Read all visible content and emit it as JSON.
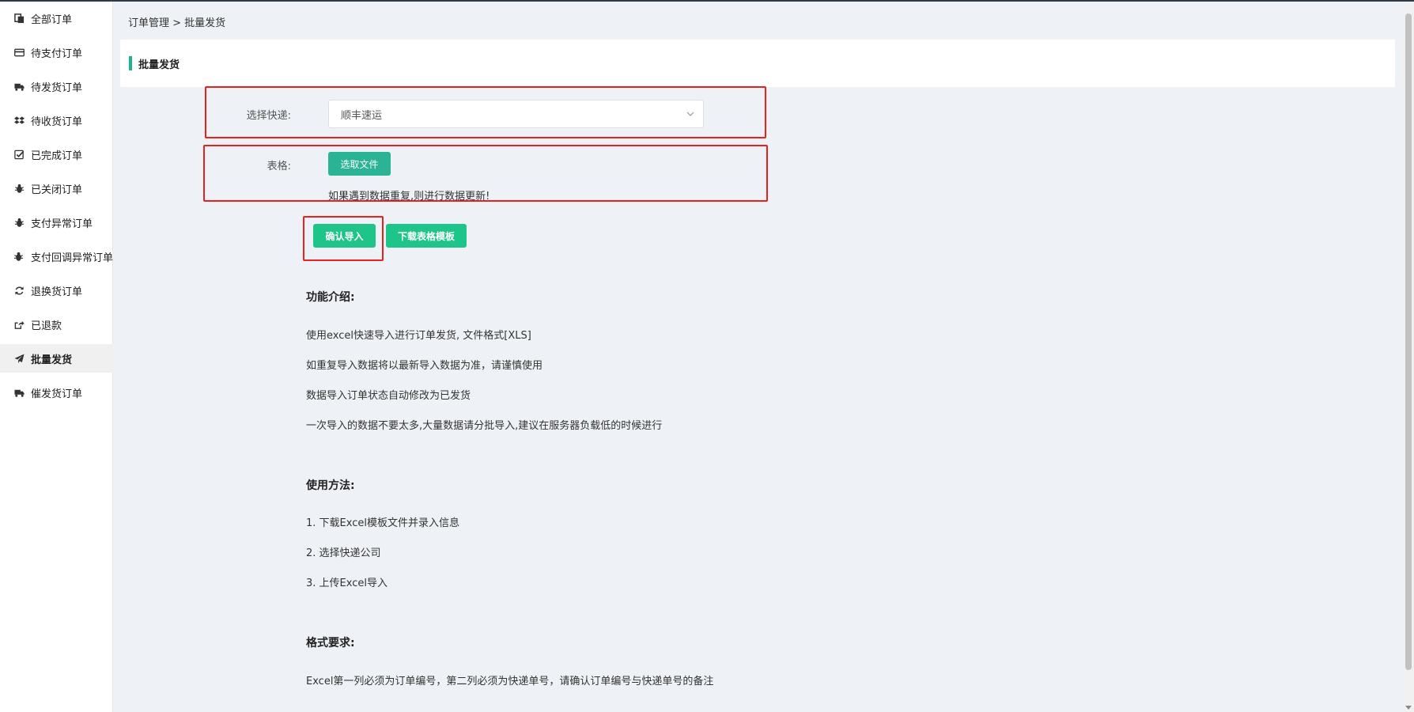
{
  "sidebar": {
    "items": [
      {
        "label": "全部订单",
        "icon": "copy-icon"
      },
      {
        "label": "待支付订单",
        "icon": "credit-card-icon"
      },
      {
        "label": "待发货订单",
        "icon": "truck-icon"
      },
      {
        "label": "待收货订单",
        "icon": "dropbox-icon"
      },
      {
        "label": "已完成订单",
        "icon": "check-square-icon"
      },
      {
        "label": "已关闭订单",
        "icon": "bug-icon"
      },
      {
        "label": "支付异常订单",
        "icon": "bug-icon"
      },
      {
        "label": "支付回调异常订单",
        "icon": "bug-icon"
      },
      {
        "label": "退换货订单",
        "icon": "refresh-icon"
      },
      {
        "label": "已退款",
        "icon": "share-square-icon"
      },
      {
        "label": "批量发货",
        "icon": "paper-plane-icon",
        "active": true
      },
      {
        "label": "催发货订单",
        "icon": "truck-icon"
      }
    ]
  },
  "breadcrumb": "订单管理 > 批量发货",
  "card": {
    "title": "批量发货"
  },
  "form": {
    "express_label": "选择快递:",
    "express_value": "顺丰速运",
    "table_label": "表格:",
    "choose_file_label": "选取文件",
    "hint": "如果遇到数据重复,则进行数据更新!",
    "confirm_label": "确认导入",
    "download_label": "下载表格模板"
  },
  "intro": {
    "title": "功能介绍:",
    "lines": [
      "使用excel快速导入进行订单发货, 文件格式[XLS]",
      "如重复导入数据将以最新导入数据为准，请谨慎使用",
      "数据导入订单状态自动修改为已发货",
      "一次导入的数据不要太多,大量数据请分批导入,建议在服务器负载低的时候进行"
    ]
  },
  "usage": {
    "title": "使用方法:",
    "lines": [
      "1. 下载Excel模板文件并录入信息",
      "2. 选择快递公司",
      "3. 上传Excel导入"
    ]
  },
  "format": {
    "title": "格式要求:",
    "lines": [
      "Excel第一列必须为订单编号，第二列必须为快递单号，请确认订单编号与快递单号的备注"
    ]
  },
  "colors": {
    "accent": "#1ab394",
    "button": "#1fc48a",
    "highlight": "#e8211d"
  }
}
